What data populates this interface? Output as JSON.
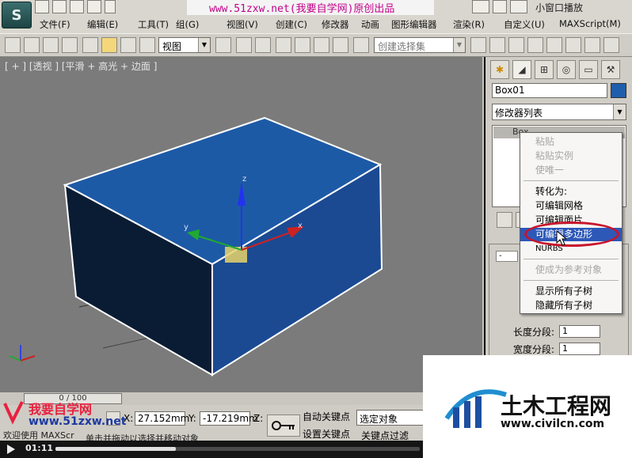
{
  "window": {
    "watermark_url": "www.51zxw.net(我要自学网)原创出品",
    "small_window_play": "小窗口播放",
    "menus": [
      "文件(F)",
      "编辑(E)",
      "工具(T)",
      "组(G)",
      "视图(V)",
      "创建(C)",
      "修改器",
      "动画",
      "图形编辑器",
      "渲染(R)",
      "自定义(U)",
      "MAXScript(M)"
    ]
  },
  "toolbar": {
    "view_dropdown": "视图",
    "selection_set": "创建选择集"
  },
  "viewport": {
    "label": "[ + ] [透视 ] [平滑 + 高光 + 边面 ]",
    "gizmo_x": "x",
    "gizmo_y": "y",
    "gizmo_z": "z"
  },
  "command_panel": {
    "object_name": "Box01",
    "object_color": "#1f5eab",
    "modifier_list": "修改器列表",
    "stack_item": "Box",
    "rollout_minus": "-",
    "length_segs_label": "长度分段:",
    "length_segs_value": "1",
    "width_segs_label": "宽度分段:",
    "width_segs_value": "1"
  },
  "context_menu": {
    "items": [
      {
        "label": "粘贴",
        "enabled": false
      },
      {
        "label": "粘贴实例",
        "enabled": false
      },
      {
        "label": "使唯一",
        "enabled": false
      },
      {
        "label": "转化为:",
        "enabled": true
      },
      {
        "label": "可编辑网格",
        "enabled": true
      },
      {
        "label": "可编辑面片",
        "enabled": true
      },
      {
        "label": "可编辑多边形",
        "enabled": true,
        "highlighted": true
      },
      {
        "label": "NURBS",
        "enabled": true
      },
      {
        "label": "使成为参考对象",
        "enabled": false
      },
      {
        "label": "显示所有子树",
        "enabled": true
      },
      {
        "label": "隐藏所有子树",
        "enabled": true
      }
    ]
  },
  "status": {
    "time_slider": "0 / 100",
    "x_label": "X:",
    "x_value": "27.152mm",
    "y_label": "Y:",
    "y_value": "-17.219mm",
    "z_label": "Z:",
    "auto_key": "自动关键点",
    "set_key": "设置关键点",
    "selected_object": "选定对象",
    "key_filter": "关键点过滤",
    "prompt": "单击并拖动以选择并移动对象",
    "maxscript": "欢迎使用 MAXScr"
  },
  "watermarks": {
    "site_cn": "我要自学网",
    "site_url": "www.51zxw.net",
    "civil_title": "土木工程网",
    "civil_url": "www.civilcn.com"
  },
  "player": {
    "time": "01:11",
    "progress": 0.33
  }
}
